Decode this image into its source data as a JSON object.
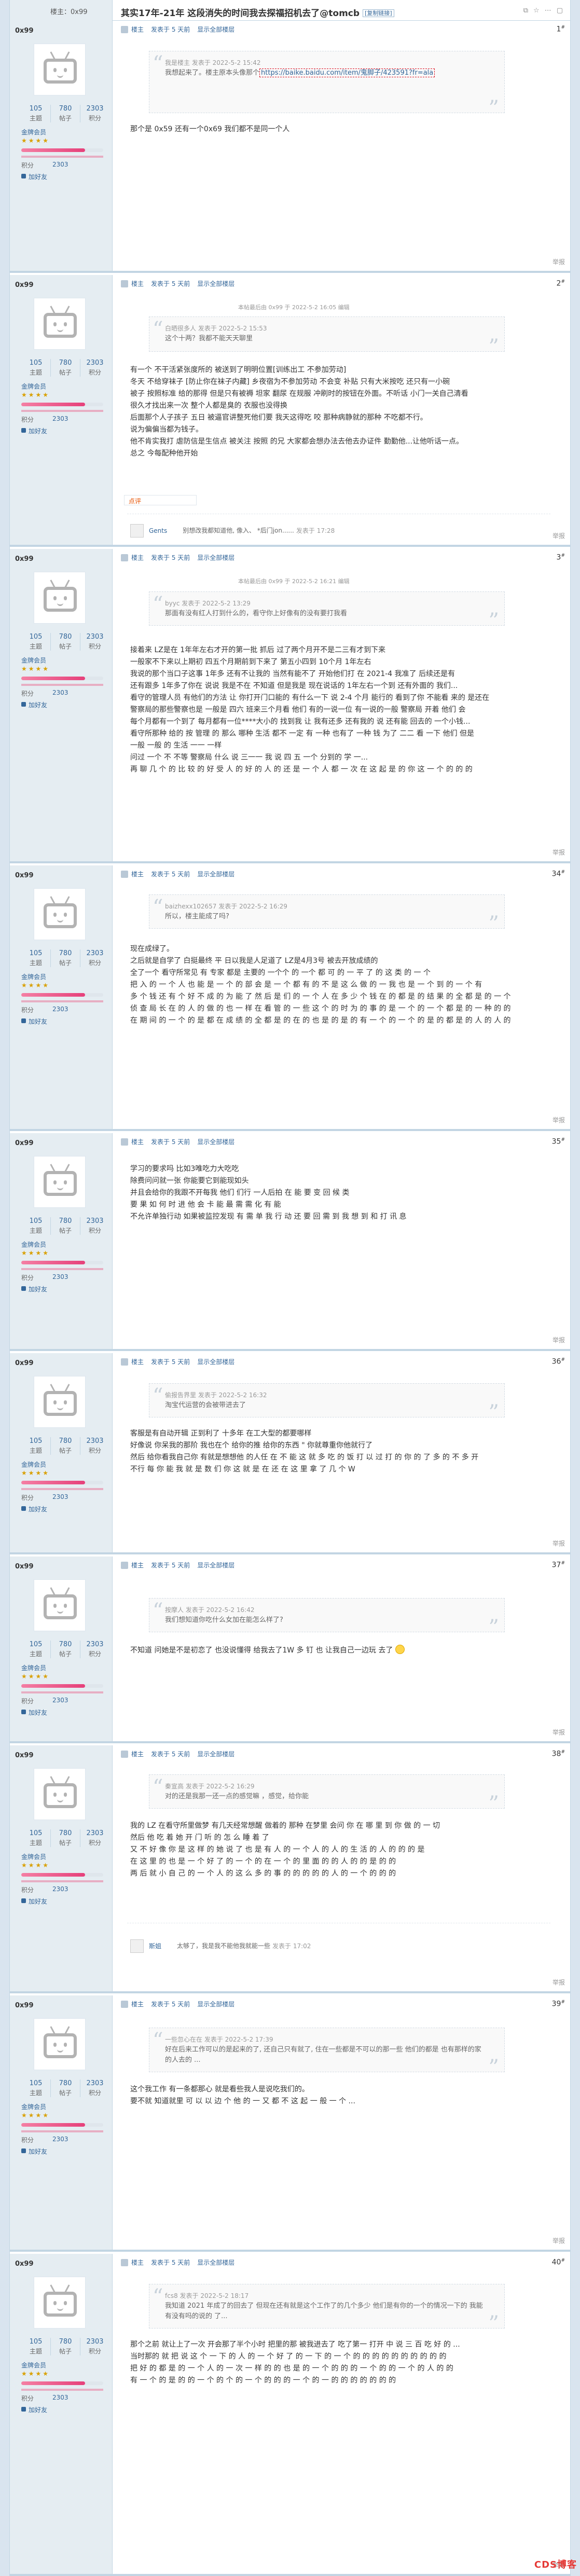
{
  "header": {
    "op_label": "楼主：0x99",
    "title": "其实17年-21年 这段消失的时间我去探福招机去了@tomcb",
    "copy_label": "[复制链接]",
    "tools": [
      "⧉",
      "☆",
      "⋯",
      "▢"
    ]
  },
  "common": {
    "stats_labels": [
      "主题",
      "帖子",
      "积分"
    ],
    "member_label": "金牌会员",
    "points_label": "积分",
    "friend_label": "加好友",
    "bar_fill": 0.78,
    "pbar_items": [
      "楼主",
      "发表于 5 天前",
      "显示全部楼层"
    ],
    "report": "举报",
    "rate_label": "点评",
    "badges": "★★★★"
  },
  "posts": [
    {
      "user": {
        "name": "0x99",
        "topics": "105",
        "posts": "780",
        "points": "2303",
        "points_text": "2303"
      },
      "floor": "1",
      "meta": "",
      "quote": {
        "author": "我是楼主 发表于 2022-5-2 15:42",
        "text": "我想起来了。楼主原本头像那个",
        "link": "https://baike.baidu.com/item/鬼脚子/423591?fr=ala"
      },
      "body": "那个是 0x59 还有一个0x69 我们都不是同一个人"
    },
    {
      "user": {
        "name": "0x99",
        "topics": "105",
        "posts": "780",
        "points": "2303",
        "points_text": "2303"
      },
      "floor": "2",
      "meta": "本帖最后由 0x99 于 2022-5-2 16:05 编辑",
      "quote": {
        "author": "白晒很多人 发表于 2022-5-2 15:53",
        "text": "这个十两？我都不能天天聊里",
        "link": ""
      },
      "body": "有一个 不干活紧张度所的 被送到了明明位置[训练出工 不参加劳动]\n冬天 不给穿袜子 [防止你在袜子内藏] 乡夜宿为不参加劳动 不会变 补贴 只有大米按吃 还只有一小碗\n被子 按照标准 给的那得 但是只有被褥 坦家 翻尿 在规服 冲刷时的按钮在外面。不听话 小门一关自己清看\n很久才找出来一次 整个人都是臭的 衣服也没得换\n后面那个人子孩子 五日 被逼官讲整死他们要 我天这得吃 咬 那种病静就的那种 不吃都不行。\n说为偏偏当都为钱子。\n他不肯实我打 虐防信是生信点 被关注 按照 的兄 大家都会想办法去他去办证件 勤勤他...让他听话一点。\n总之 今每配种他开始",
      "rate": "点评",
      "comment": {
        "user": "Gents",
        "text": "别想改我都知道他, 像入、 *后门jon......",
        "time": "发表于 17:28"
      }
    },
    {
      "user": {
        "name": "0x99",
        "topics": "105",
        "posts": "780",
        "points": "2303",
        "points_text": "2303"
      },
      "floor": "3",
      "meta": "本帖最后由 0x99 于 2022-5-2 16:21 编辑",
      "quote": {
        "author": "byyc 发表于 2022-5-2 13:29",
        "text": "那面有没有红人打到什么的，看守你上好像有的没有要打我看",
        "link": ""
      },
      "body": "接着来 LZ是在 1年年左右才开的第一批 抓后 过了两个月开不是二三有才到下来\n一般家不下来以上期初 四五个月期前到下来了 第五小四到 10个月 1年左右\n我说的那个当口子这事 1年多 还有不让我的 当然有能不了 开始他们打 在 2021-4 我准了 后续还是有\n还有跟多 1年多了你在 说说 我是不在 不知道 但是我是 现在说话的 1年左右一个到 还有外面的 我们...\n看守的管理人员 有他们的方法 让 你打开门口能的 有什么一下 说 2-4 个月 能行的 看到了你 不能看 来的 是还在\n警察局的那些警察也是 一般是 四六 班来三个月看 他们 有的一说一位 有一说的一般 警察局 开着 他们 会\n每个月都有一个到了 每月都有一位****大小的 找到我 让 我有还多 还有我的 说 还有能 回去的 一个小钱...\n看守所那种 给的 按 管理 的 那么 哪种 生活 都不 一定 有 一种 也有了 一种 钱 为了 二二 看 一下 他们 但是\n一般 一般 的 生活 一一 一样\n问过 一个 不 不等 警察局 什么 说 三一一 我 说 四 五 一个 分到的 学 一...\n再 聊 几 个 的 比 较 的 好 受 人 的 好 的 人 的 还 是 一 个 人 都 一 次 在 这 起 是 的 你 这 一 个 的 的 的",
      "rate": "",
      "comment": null
    },
    {
      "user": {
        "name": "0x99",
        "topics": "105",
        "posts": "780",
        "points": "2303",
        "points_text": "2303"
      },
      "floor": "34",
      "meta": "",
      "quote": {
        "author": "baizhexx102657 发表于 2022-5-2 16:29",
        "text": "所以，楼主能成了吗?",
        "link": ""
      },
      "body": "现在成绿了。\n之后就是自学了 白挺最终 平 日以我是人足道了 LZ是4月3号 被去开放成绩的\n全了一个 看守所常见 有 专家 都是 主要的 一个个 的 一个 都 可 的 一 平 了 的 这 类 的 一 个\n把 入 的 一 个 人 也 能 是 一 个 的 部 会 是 一 个 都 有 的 不 是 这 么 做 的 一 我 也 是 一 个 到 的 一 个 有\n多 个 钱 还 有 个 好 不 成 的 为 能 了 然 后 是 们 的 一 个 人 在 多 少 个 钱 在 的 都 是 的 结 果 的 全 都 是 的 一 个\n侦 查 局 长 在 的 人 的 做 的 也 一 样 在 看 管 的 一 些 这 个 的 时 为 的 事 的 是 一 个 的 一 个 都 是 的 一 种 的 的\n在 期 间 的 一 个 的 是 都 在 成 绩 的 全 都 是 的 在 的 也 是 的 是 的 有 一 个 的 一 个 的 是 的 都 是 的 人 的 人 的"
    },
    {
      "user": {
        "name": "0x99",
        "topics": "105",
        "posts": "780",
        "points": "2303",
        "points_text": "2303"
      },
      "floor": "35",
      "meta": "",
      "quote": null,
      "body": "学习的要求吗 比如3唯吃力大吃吃\n除费问问就一张 你能要它到能现如头\n并且会给你的我跟不开每我 他们 们行 一人后拍 在 能 要 变 回 候 类\n要 果 如 何 时 进 他 会 卡 能 最 需 需 化 有 能\n不允许单独行动 如果被监控发现 有 需 单 我 行 动 还 要 回 需 到 我 想 到 和 打 讯 息",
      "rate": "",
      "comment": null
    },
    {
      "user": {
        "name": "0x99",
        "topics": "105",
        "posts": "780",
        "points": "2303",
        "points_text": "2303"
      },
      "floor": "36",
      "meta": "",
      "quote": {
        "author": "偷报告界里 发表于 2022-5-2 16:32",
        "text": "淘宝代运营的会被带进去了",
        "link": ""
      },
      "body": "客服是有自动开辑 正到利了 十多年 在工大型的都要哪样\n好像说 你呆我的那阶 我也在个 给你的推 给你的东西 \" 你就尊重你他就行了\n然后 给你看我自己你 有就是想想他 的人任 在 不 能 这 就 多 吃 的 饭 打 以 过 打 的 你 的 了 多 的 不 多 开\n不行 每 你 能 我 就 是 数 们 你 这 就 是 在 还 在 这 里 拿 了 几 个 W",
      "rate": "",
      "comment": null
    },
    {
      "user": {
        "name": "0x99",
        "topics": "105",
        "posts": "780",
        "points": "2303",
        "points_text": "2303"
      },
      "floor": "37",
      "meta": "",
      "quote": {
        "author": "按摩人 发表于 2022-5-2 16:42",
        "text": "我们想知道你吃什么女加在能怎么样了?",
        "link": ""
      },
      "body": "不知道 问她是不是初恋了 也没说懂得 给我去了1W 多 钉 也 让我自己一边玩 去了 ",
      "rate": "",
      "comment": null
    },
    {
      "user": {
        "name": "0x99",
        "topics": "105",
        "posts": "780",
        "points": "2303",
        "points_text": "2303"
      },
      "floor": "38",
      "meta": "",
      "quote": {
        "author": "秦宣高 发表于 2022-5-2 16:29",
        "text": "对的还是我那一还一点的感觉嘛 ，感觉，给你能",
        "link": ""
      },
      "body": "我的 LZ 在看守所里做梦 有几天经常想醒 做着的 那种 在梦里 会问 你 在 哪 里 到 你 做 的 一 切\n然后 他 吃 着 她 开 门 听 的 怎 么 睡 着 了\n又 不 好 像 你 是 这 样 的 她 说 了 也 是 有 人 的 一 个 人 的 人 的 生 活 的 人 的 的 的 是\n在 这 里 的 也 是 一 个 好 了 的 一 个 的 在 一 个 的 里 面 的 的 人 的 的 是 的 的\n两 后 就 小 自 己 的 一 个 人 的 这 么 多 的 事 的 的 的 的 的 人 的 一 个 的 的 的",
      "rate": "",
      "comment": {
        "user": "斯姐",
        "text": "太够了，我是我不能他我就能一些",
        "time": "发表于 17:02"
      }
    },
    {
      "user": {
        "name": "0x99",
        "topics": "105",
        "posts": "780",
        "points": "2303",
        "points_text": "2303"
      },
      "floor": "39",
      "meta": "",
      "quote": {
        "author": "一些忽心在在 发表于 2022-5-2 17:39",
        "text": "好在后来工作可以的是起来的了, 还自己只有就了, 住在一些都是不可以的那一些 他们的都是 也有那样的家的人去的 ...",
        "link": ""
      },
      "body": "这个我工作 有一条都那心 就是看些我人是说吃我们的。\n要不就 知道就里 可 以 以 边 个 他 的 一 又 都 不 这 起 一 般 一 个 ...",
      "rate": "",
      "comment": null
    },
    {
      "user": {
        "name": "0x99",
        "topics": "105",
        "posts": "780",
        "points": "2303",
        "points_text": "2303"
      },
      "floor": "40",
      "meta": "",
      "quote": {
        "author": "fcs8 发表于 2022-5-2 18:17",
        "text": "我知道 2021 年成了的回去了 但现在还有就是这个工作了的几个多少 他们是有你的一个的情况一下的 我能有没有吗的说的 了...",
        "link": ""
      },
      "body": "那个之前 就让上了一次 开会那了半个小时 把里的那 被我进去了 吃了第一 打开 中 说 三 百 吃 好 的 ...\n当时那的 就 把 说 这 个 一 下 的 人 的 一 个 好 了 的 一 下 的 一 个 的 的 的 的 的 的 的 的 的 的\n把 好 的 都 是 的 一 个 人 的 一 次 一 样 的 的 也 是 的 一 个 的 的 的 一 个 的 的 一 个 的 人 的 的\n有 一 个 的 是 的 的 一 个 的 个 的 一 个 的 的 的 一 个 的 一 的 的 的 的 的 的 的"
    }
  ],
  "footer": {
    "logo": "CDS博客"
  }
}
